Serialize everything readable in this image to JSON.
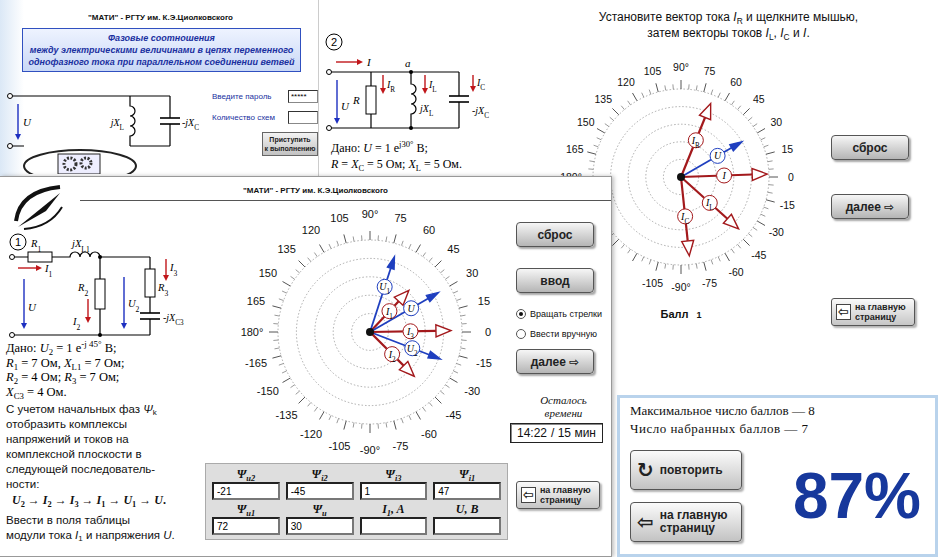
{
  "intro_window": {
    "header": "\"МАТИ\" - РГТУ им. К.Э.Циолковского",
    "title_lines": [
      "Фазовые соотношения",
      "между электрическими величинами в цепях переменного",
      "однофазного тока при параллельном соединении ветвей"
    ],
    "circuit": {
      "U": [
        {
          "t": "U",
          "k": "i"
        }
      ],
      "XL": [
        {
          "t": "jX",
          "k": "i"
        },
        {
          "t": "L",
          "k": "sub"
        }
      ],
      "XC": [
        {
          "t": "-jX",
          "k": "i"
        },
        {
          "t": "C",
          "k": "sub"
        }
      ]
    },
    "fields": [
      {
        "label": "Введите пароль",
        "value": "*****"
      },
      {
        "label": "Количество схем",
        "value": ""
      }
    ],
    "start_button": [
      "Приступить",
      "к выполнению"
    ]
  },
  "task2_window": {
    "number": "2",
    "circuit": {
      "I": [
        {
          "t": "I",
          "k": "i"
        }
      ],
      "node": [
        {
          "t": "a",
          "k": "i"
        }
      ],
      "IR": [
        {
          "t": "I",
          "k": "i"
        },
        {
          "t": "R",
          "k": "sub"
        }
      ],
      "IL": [
        {
          "t": "I",
          "k": "i"
        },
        {
          "t": "L",
          "k": "sub"
        }
      ],
      "IC": [
        {
          "t": "I",
          "k": "i"
        },
        {
          "t": "C",
          "k": "sub"
        }
      ],
      "U": [
        {
          "t": "U",
          "k": "i"
        }
      ],
      "R": [
        {
          "t": "R",
          "k": "i"
        }
      ],
      "XL": [
        {
          "t": "jX",
          "k": "i"
        },
        {
          "t": "L",
          "k": "sub"
        }
      ],
      "XC": [
        {
          "t": "-jX",
          "k": "i"
        },
        {
          "t": "C",
          "k": "sub"
        }
      ]
    },
    "given": [
      [
        {
          "t": "Дано:  "
        },
        {
          "t": "U",
          "k": "i"
        },
        {
          "t": " = 1  e"
        },
        {
          "t": "j30°",
          "k": "sup"
        },
        {
          "t": " В;"
        }
      ],
      [
        {
          "t": "R",
          "k": "i"
        },
        {
          "t": " = "
        },
        {
          "t": "X",
          "k": "i"
        },
        {
          "t": "C",
          "k": "sub"
        },
        {
          "t": " = 5  Ом; "
        },
        {
          "t": "X",
          "k": "i"
        },
        {
          "t": "L",
          "k": "sub"
        },
        {
          "t": " = 5  Ом."
        }
      ]
    ],
    "instruction": [
      [
        {
          "t": "Установите вектор тока "
        },
        {
          "t": "I",
          "k": "i"
        },
        {
          "t": "R",
          "k": "sub"
        },
        {
          "t": " и щелкните мышью,"
        }
      ],
      [
        {
          "t": "затем векторы токов "
        },
        {
          "t": "I",
          "k": "i"
        },
        {
          "t": "L",
          "k": "sub"
        },
        {
          "t": ", "
        },
        {
          "t": "I",
          "k": "i"
        },
        {
          "t": "C",
          "k": "sub"
        },
        {
          "t": " и "
        },
        {
          "t": "I",
          "k": "i"
        },
        {
          "t": "."
        }
      ]
    ],
    "dial": {
      "labels": [
        "0",
        "15",
        "30",
        "45",
        "60",
        "75",
        "90°",
        "105",
        "120",
        "135",
        "150",
        "165",
        "180°",
        "-105",
        "-90°",
        "-75",
        "-60",
        "-45",
        "-30",
        "-15"
      ],
      "vectors": [
        {
          "label": [
            {
              "t": "I",
              "k": "i"
            },
            {
              "t": "R",
              "k": "sub"
            }
          ],
          "kind": "current",
          "angle": 68,
          "length": 0.9,
          "color": "#a3191c"
        },
        {
          "label": [
            {
              "t": "U",
              "k": "i"
            }
          ],
          "kind": "voltage",
          "angle": 30,
          "length": 0.8,
          "color": "#1f3fbf"
        },
        {
          "label": [
            {
              "t": "I",
              "k": "i"
            }
          ],
          "kind": "current",
          "angle": 2,
          "length": 0.98,
          "color": "#a3191c"
        },
        {
          "label": [
            {
              "t": "I",
              "k": "i"
            },
            {
              "t": "L",
              "k": "sub"
            }
          ],
          "kind": "current",
          "angle": -42,
          "length": 0.88,
          "color": "#a3191c"
        },
        {
          "label": [
            {
              "t": "I",
              "k": "i"
            },
            {
              "t": "C",
              "k": "sub"
            }
          ],
          "kind": "current",
          "angle": -84,
          "length": 0.9,
          "color": "#a3191c"
        }
      ]
    },
    "buttons": [
      "сброс",
      "далее ⇨"
    ],
    "home_button": {
      "icon": "⇦",
      "lines": [
        "на главную",
        "страницу"
      ]
    },
    "score": {
      "label": "Балл",
      "value": "1"
    }
  },
  "task1_window": {
    "header": "\"МАТИ\" - РГТУ им. К.Э.Циолковского",
    "number": "1",
    "circuit": {
      "R1": [
        {
          "t": "R",
          "k": "i"
        },
        {
          "t": "1",
          "k": "sub"
        }
      ],
      "XL1": [
        {
          "t": "jX",
          "k": "i"
        },
        {
          "t": "L1",
          "k": "sub"
        }
      ],
      "I1": [
        {
          "t": "I",
          "k": "i"
        },
        {
          "t": "1",
          "k": "sub"
        }
      ],
      "I3": [
        {
          "t": "I",
          "k": "i"
        },
        {
          "t": "3",
          "k": "sub"
        }
      ],
      "R2": [
        {
          "t": "R",
          "k": "i"
        },
        {
          "t": "2",
          "k": "sub"
        }
      ],
      "R3": [
        {
          "t": "R",
          "k": "i"
        },
        {
          "t": "3",
          "k": "sub"
        }
      ],
      "U": [
        {
          "t": "U",
          "k": "i"
        }
      ],
      "I2": [
        {
          "t": "I",
          "k": "i"
        },
        {
          "t": "2",
          "k": "sub"
        }
      ],
      "U2": [
        {
          "t": "U",
          "k": "i"
        },
        {
          "t": "2",
          "k": "sub"
        }
      ],
      "XC3": [
        {
          "t": "-jX",
          "k": "i"
        },
        {
          "t": "C3",
          "k": "sub"
        }
      ]
    },
    "given": [
      [
        {
          "t": "Дано:  "
        },
        {
          "t": "U",
          "k": "i"
        },
        {
          "t": "2",
          "k": "sub"
        },
        {
          "t": " = 1  e"
        },
        {
          "t": "-j 45°",
          "k": "sup"
        },
        {
          "t": " В;"
        }
      ],
      [
        {
          "t": "R",
          "k": "i"
        },
        {
          "t": "1",
          "k": "sub"
        },
        {
          "t": " = 7 Ом, "
        },
        {
          "t": "X",
          "k": "i"
        },
        {
          "t": "L1",
          "k": "sub"
        },
        {
          "t": " = 7 Ом;"
        }
      ],
      [
        {
          "t": "R",
          "k": "i"
        },
        {
          "t": "2",
          "k": "sub"
        },
        {
          "t": " = 4 Ом;  "
        },
        {
          "t": "R",
          "k": "i"
        },
        {
          "t": "3",
          "k": "sub"
        },
        {
          "t": " = 7 Ом;"
        }
      ],
      [
        {
          "t": "X",
          "k": "i"
        },
        {
          "t": "C3",
          "k": "sub"
        },
        {
          "t": " = 4 Ом."
        }
      ]
    ],
    "instruction": [
      [
        {
          "t": "С учетом начальных фаз "
        },
        {
          "t": "Ψ",
          "k": "i"
        },
        {
          "t": "k",
          "k": "sub"
        }
      ],
      [
        {
          "t": "отобразить комплексы"
        }
      ],
      [
        {
          "t": "напряжений и токов на"
        }
      ],
      [
        {
          "t": "комплексной плоскости в"
        }
      ],
      [
        {
          "t": "следующей последователь-"
        }
      ],
      [
        {
          "t": "ности:"
        }
      ]
    ],
    "sequence": [
      {
        "t": "U",
        "k": "i"
      },
      {
        "t": "2",
        "k": "sub"
      },
      {
        "t": " → "
      },
      {
        "t": "I",
        "k": "i"
      },
      {
        "t": "2",
        "k": "sub"
      },
      {
        "t": " → "
      },
      {
        "t": "I",
        "k": "i"
      },
      {
        "t": "3",
        "k": "sub"
      },
      {
        "t": " → "
      },
      {
        "t": "I",
        "k": "i"
      },
      {
        "t": "1",
        "k": "sub"
      },
      {
        "t": " → "
      },
      {
        "t": "U",
        "k": "i"
      },
      {
        "t": "1",
        "k": "sub"
      },
      {
        "t": " → "
      },
      {
        "t": "U",
        "k": "i"
      },
      {
        "t": "."
      }
    ],
    "note": [
      [
        {
          "t": "Ввести в поля таблицы"
        }
      ],
      [
        {
          "t": "модули тока "
        },
        {
          "t": "I",
          "k": "i"
        },
        {
          "t": "1",
          "k": "sub"
        },
        {
          "t": " и напряжения "
        },
        {
          "t": "U",
          "k": "i"
        },
        {
          "t": "."
        }
      ]
    ],
    "dial": {
      "labels": [
        "0",
        "15",
        "30",
        "45",
        "60",
        "75",
        "90°",
        "105",
        "120",
        "135",
        "150",
        "165",
        "180°",
        "-165",
        "-150",
        "-135",
        "-120",
        "-105",
        "-90°",
        "-75",
        "-60",
        "-45",
        "-30",
        "-15"
      ],
      "vectors": [
        {
          "label": [
            {
              "t": "U",
              "k": "i"
            },
            {
              "t": "2",
              "k": "sub"
            }
          ],
          "kind": "voltage",
          "angle": -21,
          "length": 0.82,
          "color": "#1f3fbf"
        },
        {
          "label": [
            {
              "t": "I",
              "k": "i"
            },
            {
              "t": "2",
              "k": "sub"
            }
          ],
          "kind": "current",
          "angle": -45,
          "length": 0.68,
          "color": "#a3191c"
        },
        {
          "label": [
            {
              "t": "I",
              "k": "i"
            },
            {
              "t": "3",
              "k": "sub"
            }
          ],
          "kind": "current",
          "angle": 1,
          "length": 0.88,
          "color": "#a3191c"
        },
        {
          "label": [
            {
              "t": "I",
              "k": "i"
            },
            {
              "t": "1",
              "k": "sub"
            }
          ],
          "kind": "current",
          "angle": 47,
          "length": 0.62,
          "color": "#a3191c"
        },
        {
          "label": [
            {
              "t": "U",
              "k": "i"
            },
            {
              "t": "1",
              "k": "sub"
            }
          ],
          "kind": "voltage",
          "angle": 72,
          "length": 0.86,
          "color": "#1f3fbf"
        },
        {
          "label": [
            {
              "t": "U",
              "k": "i"
            }
          ],
          "kind": "voltage",
          "angle": 30,
          "length": 0.86,
          "color": "#1f3fbf"
        }
      ]
    },
    "buttons": {
      "reset": "сброс",
      "enter": "ввод",
      "next": "далее ⇨"
    },
    "modes": [
      {
        "label": "Вращать стрелки",
        "selected": true
      },
      {
        "label": "Ввести вручную",
        "selected": false
      }
    ],
    "timer": {
      "label_lines": [
        "Осталось",
        "времени"
      ],
      "value": "14:22",
      "total": "/ 15 мин"
    },
    "table": [
      {
        "header": [
          {
            "t": "Ψ"
          },
          {
            "t": "u2",
            "k": "sub"
          }
        ],
        "value": "-21"
      },
      {
        "header": [
          {
            "t": "Ψ"
          },
          {
            "t": "i2",
            "k": "sub"
          }
        ],
        "value": "-45"
      },
      {
        "header": [
          {
            "t": "Ψ"
          },
          {
            "t": "i3",
            "k": "sub"
          }
        ],
        "value": "1"
      },
      {
        "header": [
          {
            "t": "Ψ"
          },
          {
            "t": "i1",
            "k": "sub"
          }
        ],
        "value": "47"
      },
      {
        "header": [
          {
            "t": "Ψ"
          },
          {
            "t": "u1",
            "k": "sub"
          }
        ],
        "value": "72"
      },
      {
        "header": [
          {
            "t": "Ψ"
          },
          {
            "t": "u",
            "k": "sub"
          }
        ],
        "value": "30"
      },
      {
        "header": [
          {
            "t": "I",
            "k": "i"
          },
          {
            "t": "1",
            "k": "sub"
          },
          {
            "t": ", A"
          }
        ],
        "value": ""
      },
      {
        "header": [
          {
            "t": "U",
            "k": "i"
          },
          {
            "t": ", В"
          }
        ],
        "value": ""
      }
    ],
    "home_button": {
      "icon": "⇦",
      "lines": [
        "на главную",
        "страницу"
      ]
    }
  },
  "result_panel": {
    "max_score": "Максимальное число баллов — 8",
    "score": "Число  набранных  баллов — 7",
    "retry": {
      "icon": "↻",
      "label": "повторить"
    },
    "home_button": {
      "icon": "⇦",
      "lines": [
        "на главную",
        "страницу"
      ]
    },
    "percent": "87%"
  }
}
